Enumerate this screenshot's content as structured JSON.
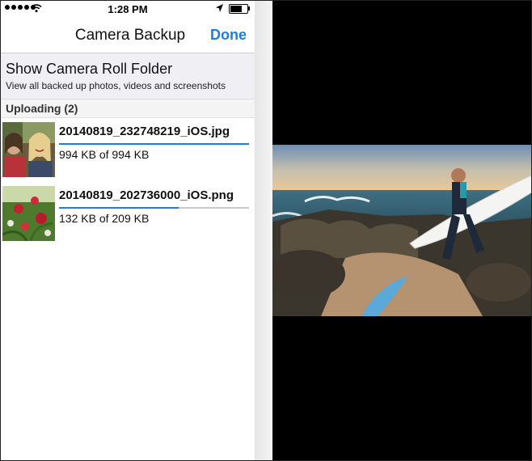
{
  "status_bar": {
    "time": "1:28 PM",
    "signal_icon": "signal-dots-icon",
    "wifi_icon": "wifi-icon",
    "location_icon": "location-arrow-icon",
    "battery_icon": "battery-icon",
    "battery_level": 0.8
  },
  "navbar": {
    "title": "Camera Backup",
    "done_label": "Done"
  },
  "folder_option": {
    "title": "Show Camera Roll Folder",
    "subtitle": "View all backed up photos, videos and screenshots"
  },
  "uploading": {
    "header": "Uploading (2)",
    "items": [
      {
        "filename": "20140819_232748219_iOS.jpg",
        "size_text": "994 KB of 994 KB",
        "progress": 1.0
      },
      {
        "filename": "20140819_202736000_iOS.png",
        "size_text": "132 KB of 209 KB",
        "progress": 0.63
      }
    ]
  },
  "colors": {
    "accent": "#1a7fe0",
    "nav_background": "#ffffff",
    "folder_row_background": "#efeff4"
  }
}
